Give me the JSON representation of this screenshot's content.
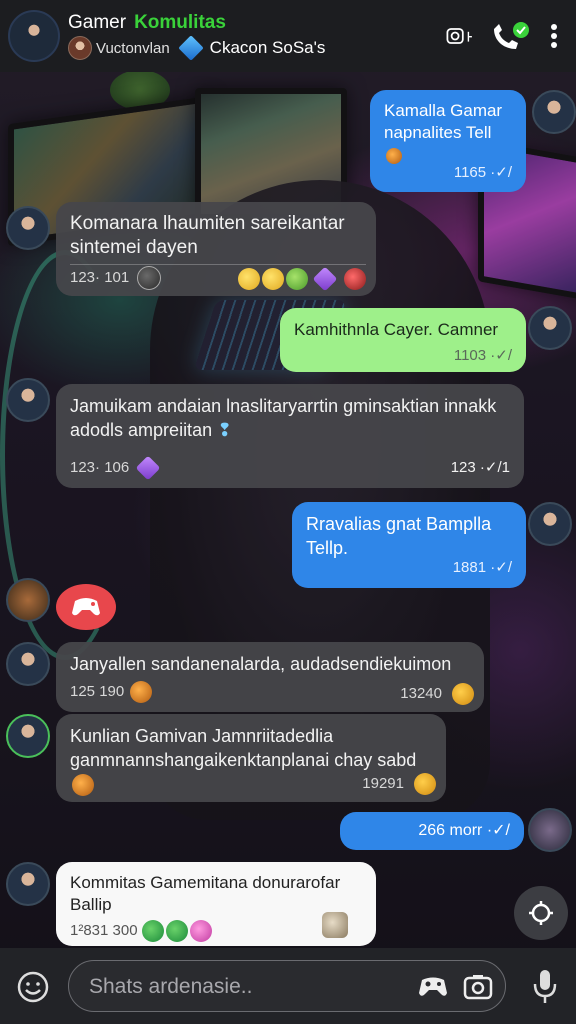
{
  "header": {
    "title": "Gamer",
    "title_accent": "Komulitas",
    "sub_name": "Vuctonvlan",
    "sub_channel": "Ckacon SoSa's",
    "icons": [
      "camera-icon",
      "call-icon",
      "more-icon"
    ]
  },
  "messages": [
    {
      "text": "Kamalla Gamar napnalites Tell",
      "time": "1165 ·✓/",
      "side": "out"
    },
    {
      "text": "Komanara lhaumiten sareikantar sintemei dayen",
      "time": "123· 101"
    },
    {
      "text": "Kamhithnla Cayer. Camner",
      "time": "1103 ·✓/"
    },
    {
      "text": "Jamuikam andaian lnaslitaryarrtin gminsaktian innakk adodls ampreiitan",
      "time_left": "123· 106",
      "time_right": "123 ·✓/1"
    },
    {
      "text": "Rravalias gnat Bamplla Tellp.",
      "time": "1881 ·✓/"
    },
    {
      "text": "Janyallen sandanenalarda, audadsendiekuimon",
      "time_left": "125 190",
      "time_right": "13240"
    },
    {
      "text": "Kunlian Gamivan Jamnriitadedlia ganmnannshangaikenktanplanai chay sabd",
      "time": "19291"
    },
    {
      "text": "266 morr ·✓/"
    },
    {
      "text": "Kommitas Gamemitana donurarofar Ballip",
      "time": "1²831 300"
    }
  ],
  "input": {
    "placeholder": "Shats ardenasie.."
  },
  "colors": {
    "accent_green": "#3ad23a",
    "bubble_blue": "#2f86e8",
    "bubble_green": "#9ef08a",
    "react_red": "#e8474c"
  }
}
